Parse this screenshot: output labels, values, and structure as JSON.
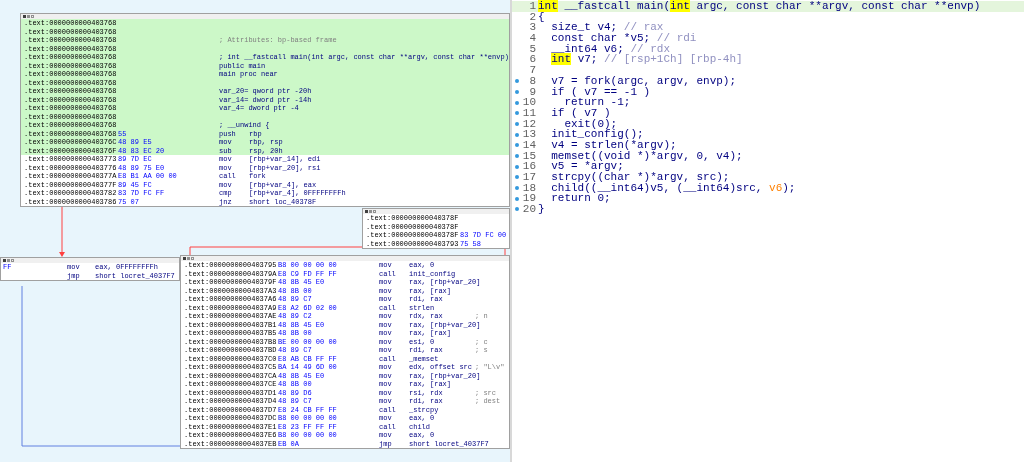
{
  "graph_view": {
    "blocks": [
      {
        "lines": [
          {
            "address": ".text:0000000000403768",
            "kind": "code",
            "highlighted": true
          },
          {
            "address": ".text:0000000000403768",
            "kind": "code",
            "highlighted": true
          },
          {
            "address": ".text:0000000000403768",
            "kind": "comment",
            "text": "; Attributes: bp-based frame",
            "highlighted": true
          },
          {
            "address": ".text:0000000000403768",
            "kind": "code",
            "highlighted": true
          },
          {
            "address": ".text:0000000000403768",
            "kind": "directive",
            "text": "; int __fastcall main(int argc, const char **argv, const char **envp)",
            "highlighted": true
          },
          {
            "address": ".text:0000000000403768",
            "kind": "directive",
            "text": "public main",
            "highlighted": true
          },
          {
            "address": ".text:0000000000403768",
            "kind": "directive",
            "text": "main proc near",
            "highlighted": true
          },
          {
            "address": ".text:0000000000403768",
            "kind": "code",
            "highlighted": true
          },
          {
            "address": ".text:0000000000403768",
            "kind": "directive",
            "text": "var_20= qword ptr -20h",
            "highlighted": true
          },
          {
            "address": ".text:0000000000403768",
            "kind": "directive",
            "text": "var_14= dword ptr -14h",
            "highlighted": true
          },
          {
            "address": ".text:0000000000403768",
            "kind": "directive",
            "text": "var_4= dword ptr -4",
            "highlighted": true
          },
          {
            "address": ".text:0000000000403768",
            "kind": "code",
            "highlighted": true
          },
          {
            "address": ".text:0000000000403768",
            "kind": "directive",
            "text": "; __unwind {",
            "highlighted": true
          },
          {
            "address": ".text:0000000000403768",
            "kind": "code",
            "bytes": "55",
            "mnemonic": "push",
            "operands": "rbp",
            "highlighted": true
          },
          {
            "address": ".text:000000000040376C",
            "kind": "code",
            "bytes": "48 89 E5",
            "mnemonic": "mov",
            "operands": "rbp, rsp",
            "highlighted": true
          },
          {
            "address": ".text:000000000040376F",
            "kind": "code",
            "bytes": "48 83 EC 20",
            "mnemonic": "sub",
            "operands": "rsp, 20h",
            "highlighted": true
          },
          {
            "address": ".text:0000000000403773",
            "kind": "code",
            "bytes": "89 7D EC",
            "mnemonic": "mov",
            "operands": "[rbp+var_14], edi",
            "highlighted": false
          },
          {
            "address": ".text:0000000000403776",
            "kind": "code",
            "bytes": "48 89 75 E0",
            "mnemonic": "mov",
            "operands": "[rbp+var_20], rsi",
            "highlighted": false
          },
          {
            "address": ".text:000000000040377A",
            "kind": "code",
            "bytes": "E8 B1 AA 00 00",
            "mnemonic": "call",
            "operands": "fork",
            "highlighted": false
          },
          {
            "address": ".text:000000000040377F",
            "kind": "code",
            "bytes": "89 45 FC",
            "mnemonic": "mov",
            "operands": "[rbp+var_4], eax",
            "highlighted": false
          },
          {
            "address": ".text:0000000000403782",
            "kind": "code",
            "bytes": "83 7D FC FF",
            "mnemonic": "cmp",
            "operands": "[rbp+var_4], 0FFFFFFFFh",
            "highlighted": false
          },
          {
            "address": ".text:0000000000403786",
            "kind": "code",
            "bytes": "75 07",
            "mnemonic": "jnz",
            "operands": "short loc_40378F",
            "highlighted": false
          }
        ]
      },
      {
        "lines": [
          {
            "address": ".text:000000000040378F",
            "kind": "code",
            "highlighted": false
          },
          {
            "address": ".text:000000000040378F",
            "kind": "code",
            "highlighted": false
          },
          {
            "address": ".text:000000000040378F",
            "kind": "code",
            "bytes": "83 7D FC 00",
            "highlighted": false
          },
          {
            "address": ".text:0000000000403793",
            "kind": "code",
            "bytes": "75 58",
            "highlighted": false
          }
        ]
      },
      {
        "lines": [
          {
            "kind": "code",
            "bytes": "FF",
            "mnemonic": "mov",
            "operands": "eax, 0FFFFFFFFh",
            "highlighted": false
          },
          {
            "kind": "code",
            "mnemonic": "jmp",
            "operands": "short locret_4037F7",
            "highlighted": false
          }
        ]
      },
      {
        "lines": [
          {
            "address": ".text:0000000000403795",
            "kind": "code",
            "bytes": "B8 00 00 00 00",
            "mnemonic": "mov",
            "operands": "eax, 0",
            "highlighted": false
          },
          {
            "address": ".text:000000000040379A",
            "kind": "code",
            "bytes": "E8 C9 FD FF FF",
            "mnemonic": "call",
            "operands": "init_config",
            "highlighted": false
          },
          {
            "address": ".text:000000000040379F",
            "kind": "code",
            "bytes": "48 8B 45 E0",
            "mnemonic": "mov",
            "operands": "rax, [rbp+var_20]",
            "highlighted": false
          },
          {
            "address": ".text:00000000004037A3",
            "kind": "code",
            "bytes": "48 8B 00",
            "mnemonic": "mov",
            "operands": "rax, [rax]",
            "highlighted": false
          },
          {
            "address": ".text:00000000004037A6",
            "kind": "code",
            "bytes": "48 89 C7",
            "mnemonic": "mov",
            "operands": "rdi, rax",
            "highlighted": false
          },
          {
            "address": ".text:00000000004037A9",
            "kind": "code",
            "bytes": "E8 A2 6D 02 00",
            "mnemonic": "call",
            "operands": "strlen",
            "highlighted": false
          },
          {
            "address": ".text:00000000004037AE",
            "kind": "code",
            "bytes": "48 89 C2",
            "mnemonic": "mov",
            "operands": "rdx, rax",
            "comment": "; n",
            "highlighted": false
          },
          {
            "address": ".text:00000000004037B1",
            "kind": "code",
            "bytes": "48 8B 45 E0",
            "mnemonic": "mov",
            "operands": "rax, [rbp+var_20]",
            "highlighted": false
          },
          {
            "address": ".text:00000000004037B5",
            "kind": "code",
            "bytes": "48 8B 00",
            "mnemonic": "mov",
            "operands": "rax, [rax]",
            "highlighted": false
          },
          {
            "address": ".text:00000000004037B8",
            "kind": "code",
            "bytes": "BE 00 00 00 00",
            "mnemonic": "mov",
            "operands": "esi, 0",
            "comment": "; c",
            "highlighted": false
          },
          {
            "address": ".text:00000000004037BD",
            "kind": "code",
            "bytes": "48 89 C7",
            "mnemonic": "mov",
            "operands": "rdi, rax",
            "comment": "; s",
            "highlighted": false
          },
          {
            "address": ".text:00000000004037C0",
            "kind": "code",
            "bytes": "E8 AB CB FF FF",
            "mnemonic": "call",
            "operands": "_memset",
            "highlighted": false
          },
          {
            "address": ".text:00000000004037C5",
            "kind": "code",
            "bytes": "BA 14 49 6D 00",
            "mnemonic": "mov",
            "operands": "edx, offset src",
            "comment": "; \"L\\v\"",
            "highlighted": false
          },
          {
            "address": ".text:00000000004037CA",
            "kind": "code",
            "bytes": "48 8B 45 E0",
            "mnemonic": "mov",
            "operands": "rax, [rbp+var_20]",
            "highlighted": false
          },
          {
            "address": ".text:00000000004037CE",
            "kind": "code",
            "bytes": "48 8B 00",
            "mnemonic": "mov",
            "operands": "rax, [rax]",
            "highlighted": false
          },
          {
            "address": ".text:00000000004037D1",
            "kind": "code",
            "bytes": "48 89 D6",
            "mnemonic": "mov",
            "operands": "rsi, rdx",
            "comment": "; src",
            "highlighted": false
          },
          {
            "address": ".text:00000000004037D4",
            "kind": "code",
            "bytes": "48 89 C7",
            "mnemonic": "mov",
            "operands": "rdi, rax",
            "comment": "; dest",
            "highlighted": false
          },
          {
            "address": ".text:00000000004037D7",
            "kind": "code",
            "bytes": "E8 24 CB FF FF",
            "mnemonic": "call",
            "operands": "_strcpy",
            "highlighted": false
          },
          {
            "address": ".text:00000000004037DC",
            "kind": "code",
            "bytes": "B8 00 00 00 00",
            "mnemonic": "mov",
            "operands": "eax, 0",
            "highlighted": false
          },
          {
            "address": ".text:00000000004037E1",
            "kind": "code",
            "bytes": "E8 23 FF FF FF",
            "mnemonic": "call",
            "operands": "child",
            "highlighted": false
          },
          {
            "address": ".text:00000000004037E6",
            "kind": "code",
            "bytes": "B8 00 00 00 00",
            "mnemonic": "mov",
            "operands": "eax, 0",
            "highlighted": false
          },
          {
            "address": ".text:00000000004037EB",
            "kind": "code",
            "bytes": "EB 0A",
            "mnemonic": "jmp",
            "operands": "short locret_4037F7",
            "highlighted": false
          }
        ]
      }
    ]
  },
  "pseudocode": {
    "lines": [
      {
        "number": "1",
        "marked": false,
        "current": true,
        "segments": [
          {
            "kind": "highlight",
            "text": "int"
          },
          {
            "kind": "code",
            "text": " __fastcall main("
          },
          {
            "kind": "highlight",
            "text": "int"
          },
          {
            "kind": "code",
            "text": " argc, const char **argv, const char **envp)"
          }
        ]
      },
      {
        "number": "2",
        "marked": false,
        "current": false,
        "segments": [
          {
            "kind": "code",
            "text": "{"
          }
        ]
      },
      {
        "number": "3",
        "marked": false,
        "current": false,
        "segments": [
          {
            "kind": "code",
            "text": "  size_t v4; "
          },
          {
            "kind": "comment",
            "text": "// rax"
          }
        ]
      },
      {
        "number": "4",
        "marked": false,
        "current": false,
        "segments": [
          {
            "kind": "code",
            "text": "  const char *v5; "
          },
          {
            "kind": "comment",
            "text": "// rdi"
          }
        ]
      },
      {
        "number": "5",
        "marked": false,
        "current": false,
        "segments": [
          {
            "kind": "code",
            "text": "  __int64 v6; "
          },
          {
            "kind": "comment",
            "text": "// rdx"
          }
        ]
      },
      {
        "number": "6",
        "marked": false,
        "current": false,
        "segments": [
          {
            "kind": "highlight",
            "text": "  int"
          },
          {
            "kind": "code",
            "text": " v7; "
          },
          {
            "kind": "comment",
            "text": "// [rsp+1Ch] [rbp-4h]"
          }
        ]
      },
      {
        "number": "7",
        "marked": false,
        "current": false
      },
      {
        "number": "8",
        "marked": true,
        "current": false,
        "segments": [
          {
            "kind": "code",
            "text": "  v7 = fork(argc, argv, envp);"
          }
        ]
      },
      {
        "number": "9",
        "marked": true,
        "current": false,
        "segments": [
          {
            "kind": "code",
            "text": "  if ( v7 == -1 )"
          }
        ]
      },
      {
        "number": "10",
        "marked": true,
        "current": false,
        "segments": [
          {
            "kind": "code",
            "text": "    return -1;"
          }
        ]
      },
      {
        "number": "11",
        "marked": true,
        "current": false,
        "segments": [
          {
            "kind": "code",
            "text": "  if ( v7 )"
          }
        ]
      },
      {
        "number": "12",
        "marked": true,
        "current": false,
        "segments": [
          {
            "kind": "code",
            "text": "    exit(0);"
          }
        ]
      },
      {
        "number": "13",
        "marked": true,
        "current": false,
        "segments": [
          {
            "kind": "code",
            "text": "  init_config();"
          }
        ]
      },
      {
        "number": "14",
        "marked": true,
        "current": false,
        "segments": [
          {
            "kind": "code",
            "text": "  v4 = strlen(*argv);"
          }
        ]
      },
      {
        "number": "15",
        "marked": true,
        "current": false,
        "segments": [
          {
            "kind": "code",
            "text": "  memset((void *)*argv, 0, v4);"
          }
        ]
      },
      {
        "number": "16",
        "marked": true,
        "current": false,
        "segments": [
          {
            "kind": "code",
            "text": "  v5 = *argv;"
          }
        ]
      },
      {
        "number": "17",
        "marked": true,
        "current": false,
        "segments": [
          {
            "kind": "code",
            "text": "  strcpy((char *)*argv, src);"
          }
        ]
      },
      {
        "number": "18",
        "marked": true,
        "current": false,
        "segments": [
          {
            "kind": "code",
            "text": "  child((__int64)v5, (__int64)src, "
          },
          {
            "kind": "accent",
            "text": "v6"
          },
          {
            "kind": "code",
            "text": ");"
          }
        ]
      },
      {
        "number": "19",
        "marked": true,
        "current": false,
        "segments": [
          {
            "kind": "code",
            "text": "  return 0;"
          }
        ]
      },
      {
        "number": "20",
        "marked": true,
        "current": false,
        "segments": [
          {
            "kind": "code",
            "text": "}"
          }
        ]
      }
    ]
  }
}
